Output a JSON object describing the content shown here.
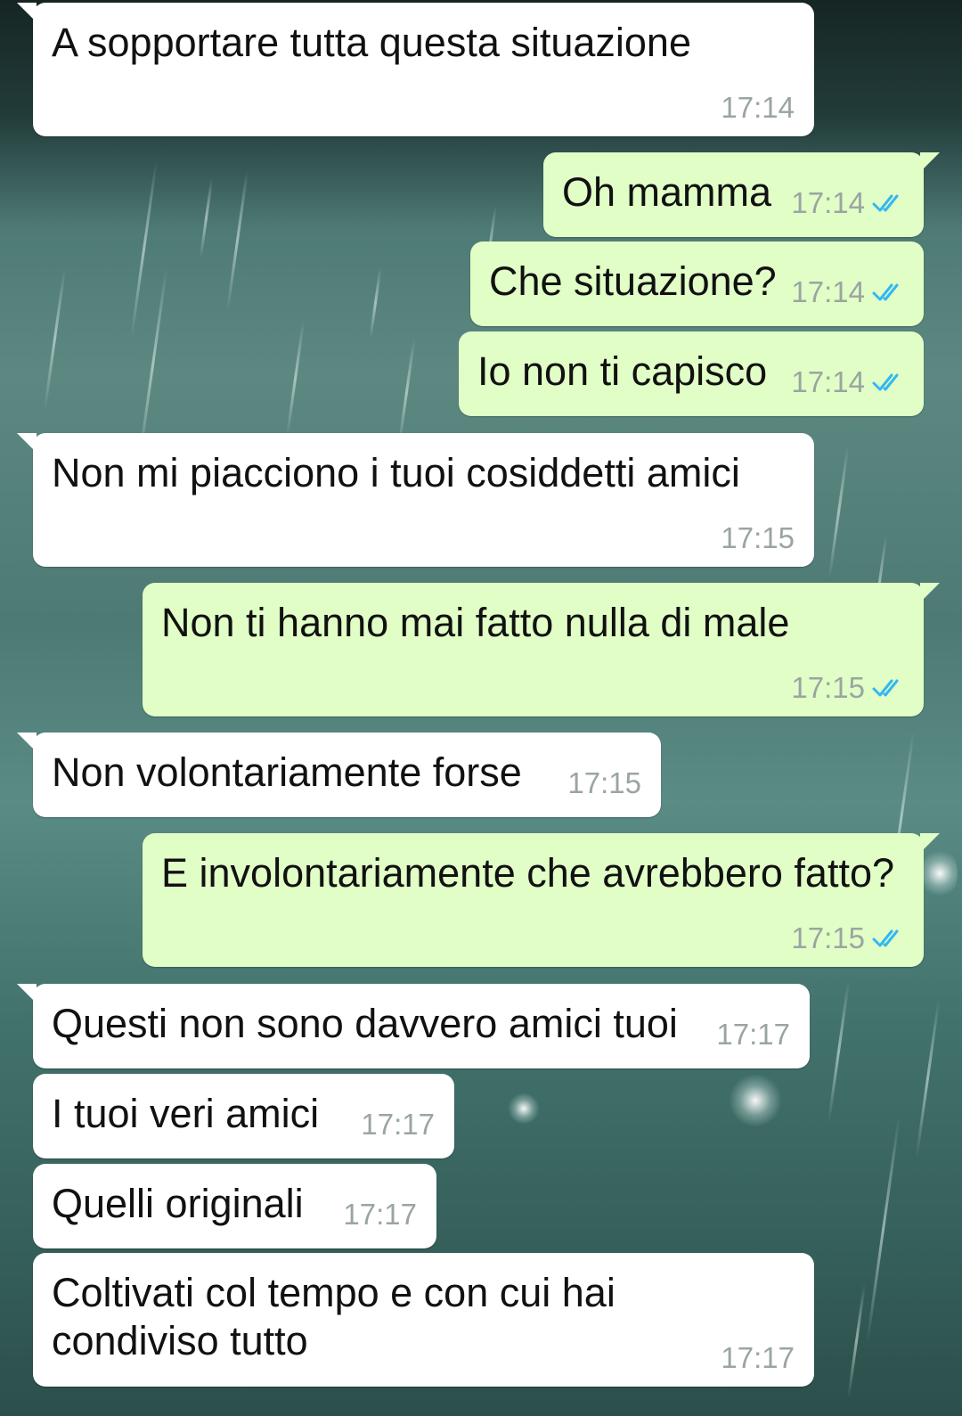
{
  "theme": {
    "incoming_bubble": "#ffffff",
    "outgoing_bubble": "#e1fec6",
    "timestamp_color": "#9aa5a2",
    "read_ticks_color": "#34b7f1"
  },
  "messages": [
    {
      "direction": "incoming",
      "text": "A sopportare tutta questa situazione",
      "time": "17:14"
    },
    {
      "direction": "outgoing",
      "text": "Oh mamma",
      "time": "17:14",
      "status_icon": "double-check-read-icon"
    },
    {
      "direction": "outgoing",
      "text": "Che situazione?",
      "time": "17:14",
      "status_icon": "double-check-read-icon"
    },
    {
      "direction": "outgoing",
      "text": "Io non ti capisco",
      "time": "17:14",
      "status_icon": "double-check-read-icon"
    },
    {
      "direction": "incoming",
      "text": "Non mi piacciono i tuoi cosiddetti amici",
      "time": "17:15"
    },
    {
      "direction": "outgoing",
      "text": "Non ti hanno mai fatto nulla di male",
      "time": "17:15",
      "status_icon": "double-check-read-icon"
    },
    {
      "direction": "incoming",
      "text": "Non volontariamente forse",
      "time": "17:15"
    },
    {
      "direction": "outgoing",
      "text": "E involontariamente che avrebbero fatto?",
      "time": "17:15",
      "status_icon": "double-check-read-icon"
    },
    {
      "direction": "incoming",
      "text": "Questi non sono davvero amici tuoi",
      "time": "17:17"
    },
    {
      "direction": "incoming",
      "text": "I tuoi veri amici",
      "time": "17:17"
    },
    {
      "direction": "incoming",
      "text": "Quelli originali",
      "time": "17:17"
    },
    {
      "direction": "incoming",
      "text": "Coltivati col tempo e con cui hai\ncondiviso tutto",
      "time": "17:17"
    }
  ]
}
